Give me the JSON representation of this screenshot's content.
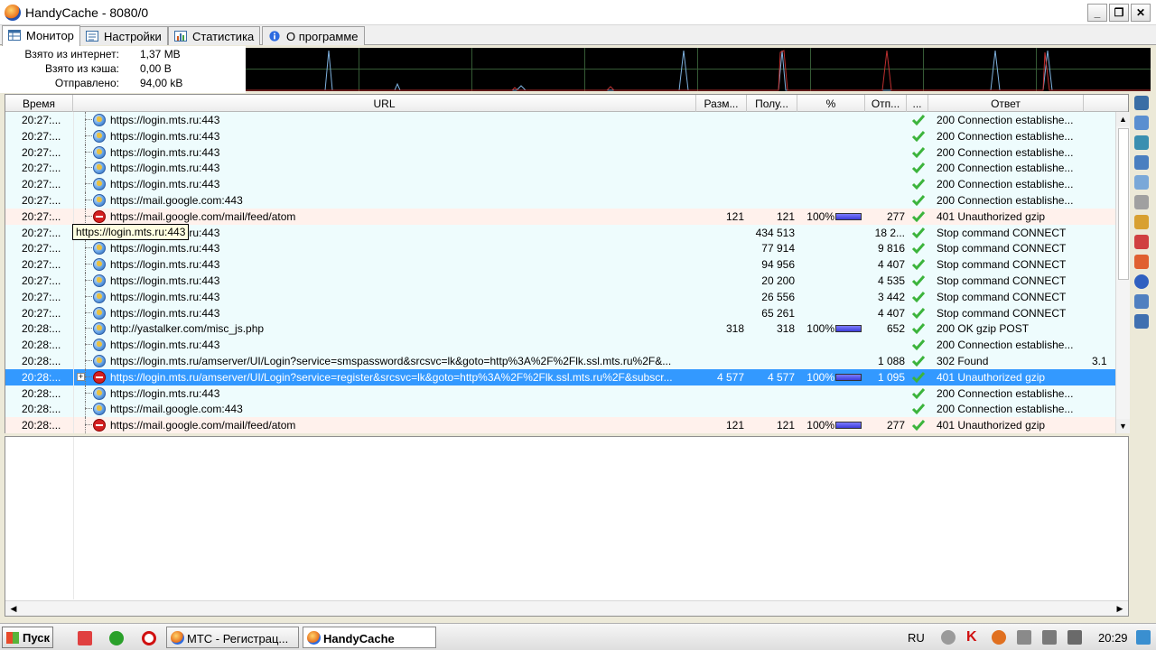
{
  "window": {
    "title": "HandyCache - 8080/0"
  },
  "tabs": [
    {
      "label": "Монитор",
      "active": true
    },
    {
      "label": "Настройки",
      "active": false
    },
    {
      "label": "Статистика",
      "active": false
    },
    {
      "label": "О программе",
      "active": false
    }
  ],
  "stats": [
    {
      "label": "Взято из интернет:",
      "value": "1,37 MB"
    },
    {
      "label": "Взято из кэша:",
      "value": "0,00 B"
    },
    {
      "label": "Отправлено:",
      "value": "94,00 kB"
    }
  ],
  "columns": {
    "time": "Время",
    "url": "URL",
    "size": "Разм...",
    "received": "Полу...",
    "percent": "%",
    "sent": "Отп...",
    "status": "...",
    "response": "Ответ"
  },
  "rows": [
    {
      "time": "20:27:...",
      "url": "https://login.mts.ru:443",
      "size": "",
      "received": "",
      "percent": "",
      "bar": 0,
      "sent": "",
      "response": "200 Connection establishe...",
      "extra": "",
      "icon": "globe",
      "kind": "ok",
      "expander": ""
    },
    {
      "time": "20:27:...",
      "url": "https://login.mts.ru:443",
      "size": "",
      "received": "",
      "percent": "",
      "bar": 0,
      "sent": "",
      "response": "200 Connection establishe...",
      "extra": "",
      "icon": "globe",
      "kind": "ok",
      "expander": ""
    },
    {
      "time": "20:27:...",
      "url": "https://login.mts.ru:443",
      "size": "",
      "received": "",
      "percent": "",
      "bar": 0,
      "sent": "",
      "response": "200 Connection establishe...",
      "extra": "",
      "icon": "globe",
      "kind": "ok",
      "expander": ""
    },
    {
      "time": "20:27:...",
      "url": "https://login.mts.ru:443",
      "size": "",
      "received": "",
      "percent": "",
      "bar": 0,
      "sent": "",
      "response": "200 Connection establishe...",
      "extra": "",
      "icon": "globe",
      "kind": "ok",
      "expander": ""
    },
    {
      "time": "20:27:...",
      "url": "https://login.mts.ru:443",
      "size": "",
      "received": "",
      "percent": "",
      "bar": 0,
      "sent": "",
      "response": "200 Connection establishe...",
      "extra": "",
      "icon": "globe",
      "kind": "ok",
      "expander": ""
    },
    {
      "time": "20:27:...",
      "url": "https://mail.google.com:443",
      "size": "",
      "received": "",
      "percent": "",
      "bar": 0,
      "sent": "",
      "response": "200 Connection establishe...",
      "extra": "",
      "icon": "globe",
      "kind": "ok",
      "expander": ""
    },
    {
      "time": "20:27:...",
      "url": "https://mail.google.com/mail/feed/atom",
      "size": "121",
      "received": "121",
      "percent": "100%",
      "bar": 1,
      "sent": "277",
      "response": "401 Unauthorized gzip",
      "extra": "",
      "icon": "stop",
      "kind": "err",
      "expander": ""
    },
    {
      "time": "20:27:...",
      "url": "https://login.mts.ru:443",
      "size": "",
      "received": "434 513",
      "percent": "",
      "bar": 0,
      "sent": "18 2...",
      "response": "Stop command CONNECT",
      "extra": "",
      "icon": "globe",
      "kind": "ok",
      "expander": ""
    },
    {
      "time": "20:27:...",
      "url": "https://login.mts.ru:443",
      "size": "",
      "received": "77 914",
      "percent": "",
      "bar": 0,
      "sent": "9 816",
      "response": "Stop command CONNECT",
      "extra": "",
      "icon": "globe",
      "kind": "ok",
      "expander": ""
    },
    {
      "time": "20:27:...",
      "url": "https://login.mts.ru:443",
      "size": "",
      "received": "94 956",
      "percent": "",
      "bar": 0,
      "sent": "4 407",
      "response": "Stop command CONNECT",
      "extra": "",
      "icon": "globe",
      "kind": "ok",
      "expander": ""
    },
    {
      "time": "20:27:...",
      "url": "https://login.mts.ru:443",
      "size": "",
      "received": "20 200",
      "percent": "",
      "bar": 0,
      "sent": "4 535",
      "response": "Stop command CONNECT",
      "extra": "",
      "icon": "globe",
      "kind": "ok",
      "expander": ""
    },
    {
      "time": "20:27:...",
      "url": "https://login.mts.ru:443",
      "size": "",
      "received": "26 556",
      "percent": "",
      "bar": 0,
      "sent": "3 442",
      "response": "Stop command CONNECT",
      "extra": "",
      "icon": "globe",
      "kind": "ok",
      "expander": ""
    },
    {
      "time": "20:27:...",
      "url": "https://login.mts.ru:443",
      "size": "",
      "received": "65 261",
      "percent": "",
      "bar": 0,
      "sent": "4 407",
      "response": "Stop command CONNECT",
      "extra": "",
      "icon": "globe",
      "kind": "ok",
      "expander": ""
    },
    {
      "time": "20:28:...",
      "url": "http://yastalker.com/misc_js.php",
      "size": "318",
      "received": "318",
      "percent": "100%",
      "bar": 1,
      "sent": "652",
      "response": "200 OK gzip POST",
      "extra": "",
      "icon": "globe",
      "kind": "ok",
      "expander": ""
    },
    {
      "time": "20:28:...",
      "url": "https://login.mts.ru:443",
      "size": "",
      "received": "",
      "percent": "",
      "bar": 0,
      "sent": "",
      "response": "200 Connection establishe...",
      "extra": "",
      "icon": "globe",
      "kind": "ok",
      "expander": ""
    },
    {
      "time": "20:28:...",
      "url": "https://login.mts.ru/amserver/UI/Login?service=smspassword&srcsvc=lk&goto=http%3A%2F%2Flk.ssl.mts.ru%2F&...",
      "size": "",
      "received": "",
      "percent": "",
      "bar": 0,
      "sent": "1 088",
      "response": "302 Found",
      "extra": "3.1",
      "icon": "globe",
      "kind": "ok",
      "expander": ""
    },
    {
      "time": "20:28:...",
      "url": "https://login.mts.ru/amserver/UI/Login?service=register&srcsvc=lk&goto=http%3A%2F%2Flk.ssl.mts.ru%2F&subscr...",
      "size": "4 577",
      "received": "4 577",
      "percent": "100%",
      "bar": 1,
      "sent": "1 095",
      "response": "401 Unauthorized gzip",
      "extra": "",
      "icon": "stop",
      "kind": "sel",
      "expander": "+"
    },
    {
      "time": "20:28:...",
      "url": "https://login.mts.ru:443",
      "size": "",
      "received": "",
      "percent": "",
      "bar": 0,
      "sent": "",
      "response": "200 Connection establishe...",
      "extra": "",
      "icon": "globe",
      "kind": "ok",
      "expander": ""
    },
    {
      "time": "20:28:...",
      "url": "https://mail.google.com:443",
      "size": "",
      "received": "",
      "percent": "",
      "bar": 0,
      "sent": "",
      "response": "200 Connection establishe...",
      "extra": "",
      "icon": "globe",
      "kind": "ok",
      "expander": ""
    },
    {
      "time": "20:28:...",
      "url": "https://mail.google.com/mail/feed/atom",
      "size": "121",
      "received": "121",
      "percent": "100%",
      "bar": 1,
      "sent": "277",
      "response": "401 Unauthorized gzip",
      "extra": "",
      "icon": "stop",
      "kind": "err",
      "expander": ""
    }
  ],
  "tooltip": "https://login.mts.ru:443",
  "icons": {
    "ok": "check-icon",
    "globe": "globe-icon",
    "stop": "stop-icon"
  },
  "colors": {
    "row_ok": "#eefcfd",
    "row_error": "#fff1ec",
    "row_selected": "#3399ff",
    "graph_bg": "#000000",
    "check": "#3cb43c"
  },
  "taskbar": {
    "start_label": "Пуск",
    "tasks": [
      {
        "label": "МТС - Регистрац...",
        "active": false
      },
      {
        "label": "HandyCache",
        "active": true
      }
    ],
    "language": "RU",
    "clock": "20:29"
  }
}
